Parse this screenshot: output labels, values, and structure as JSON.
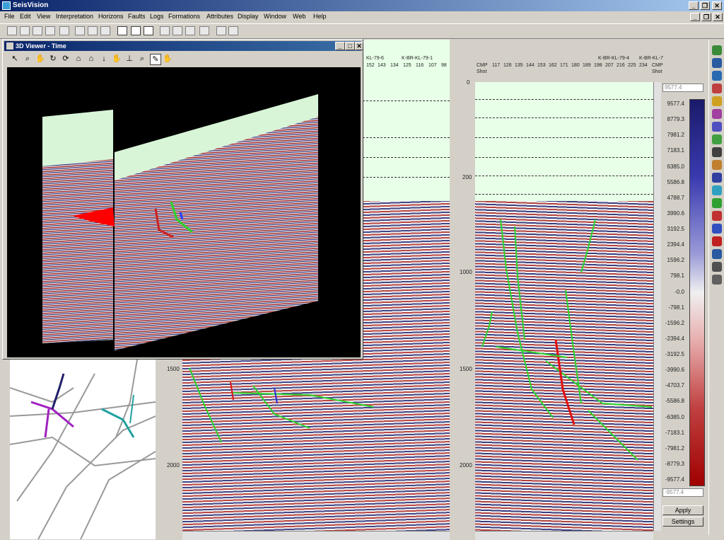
{
  "app": {
    "title": "SeisVision"
  },
  "menu": [
    "File",
    "Edit",
    "View",
    "Interpretation",
    "Horizons",
    "Faults",
    "Logs",
    "Formations",
    "Attributes",
    "Display",
    "Window",
    "Web",
    "Help"
  ],
  "viewer3d": {
    "title": "3D Viewer - Time"
  },
  "panel_left": {
    "header_lines": [
      "KL-79-6",
      "K-BR-KL-79-1"
    ],
    "traces": [
      "152",
      "143",
      "134",
      "125",
      "116",
      "107",
      "98"
    ],
    "time_labels": [
      "1500",
      "2000"
    ]
  },
  "panel_right": {
    "header_lines": [
      "K-BR-KL-79-4",
      "K-BR-KL-7"
    ],
    "cmp_label": "CMP",
    "shot_label": "Shot",
    "traces": [
      "117",
      "126",
      "135",
      "144",
      "153",
      "162",
      "171",
      "180",
      "189",
      "198",
      "207",
      "216",
      "225",
      "234"
    ],
    "time_labels": [
      "0",
      "200",
      "1000",
      "1500",
      "2000"
    ]
  },
  "colorscale": {
    "top_field": "9577.4",
    "bottom_field": "-9577.4",
    "labels": [
      "9577.4",
      "8779.3",
      "7981.2",
      "7183.1",
      "6385.0",
      "5586.8",
      "4788.7",
      "3990.6",
      "3192.5",
      "2394.4",
      "1596.2",
      "798.1",
      "-0.0",
      "-798.1",
      "-1596.2",
      "-2394.4",
      "-3192.5",
      "-3990.6",
      "-4703.7",
      "-5586.8",
      "-6385.0",
      "-7183.1",
      "-7981.2",
      "-8779.3",
      "-9577.4"
    ],
    "apply_label": "Apply",
    "settings_label": "Settings"
  },
  "colors": {
    "accent": "#0a246a",
    "fault_green": "#2bd42b",
    "fault_red": "#e01010"
  }
}
